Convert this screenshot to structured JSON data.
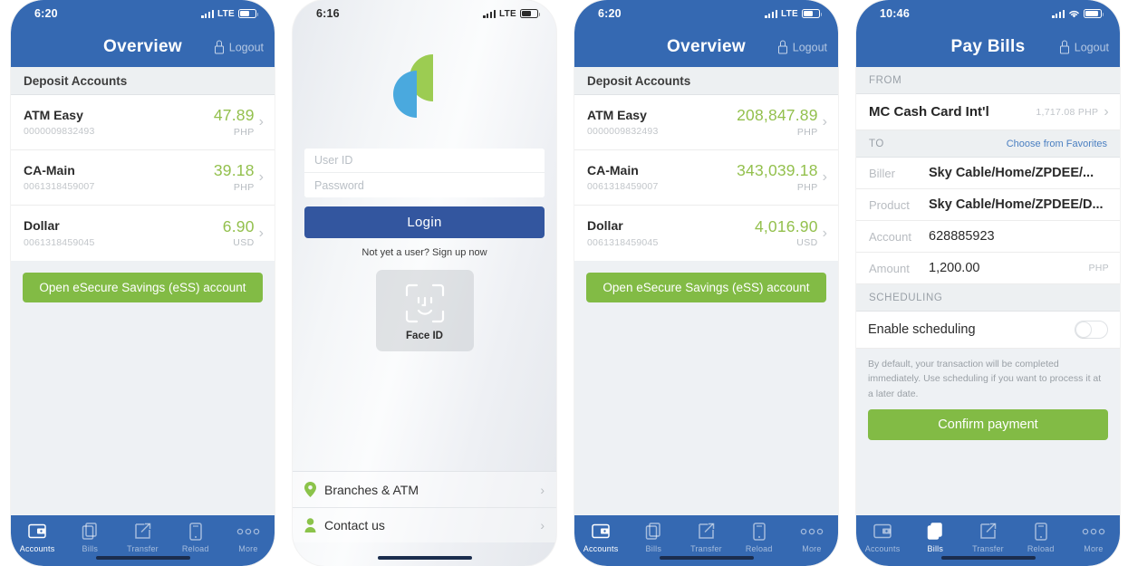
{
  "screens": [
    {
      "id": "overview-small",
      "status": {
        "time": "6:20",
        "network": "LTE",
        "signal_icon": "signal-bars-icon",
        "battery_icon": "battery-icon"
      },
      "nav": {
        "title": "Overview",
        "logout_label": "Logout",
        "logout_icon": "lock-icon"
      },
      "section_header": "Deposit Accounts",
      "accounts": [
        {
          "name": "ATM Easy",
          "number": "0000009832493",
          "balance": "47.89",
          "currency": "PHP"
        },
        {
          "name": "CA-Main",
          "number": "0061318459007",
          "balance": "39.18",
          "currency": "PHP"
        },
        {
          "name": "Dollar",
          "number": "0061318459045",
          "balance": "6.90",
          "currency": "USD"
        }
      ],
      "cta_label": "Open eSecure Savings (eSS) account",
      "tabs": [
        {
          "label": "Accounts",
          "icon": "wallet-icon",
          "active": true
        },
        {
          "label": "Bills",
          "icon": "documents-icon",
          "active": false
        },
        {
          "label": "Transfer",
          "icon": "compose-icon",
          "active": false
        },
        {
          "label": "Reload",
          "icon": "phone-icon",
          "active": false
        },
        {
          "label": "More",
          "icon": "ellipsis-icon",
          "active": false
        }
      ]
    },
    {
      "id": "login",
      "status": {
        "time": "6:16",
        "network": "LTE",
        "signal_icon": "signal-bars-icon",
        "battery_icon": "battery-icon"
      },
      "logo_icon": "bank-s-logo",
      "fields": [
        {
          "name": "user-id",
          "placeholder": "User ID",
          "value": ""
        },
        {
          "name": "password",
          "placeholder": "Password",
          "value": ""
        }
      ],
      "login_label": "Login",
      "signup_text": "Not yet a user?  Sign up now",
      "faceid": {
        "label": "Face ID",
        "icon": "face-id-icon"
      },
      "links": [
        {
          "label": "Branches & ATM",
          "icon": "map-pin-icon"
        },
        {
          "label": "Contact us",
          "icon": "person-icon"
        }
      ]
    },
    {
      "id": "overview-large",
      "status": {
        "time": "6:20",
        "network": "LTE",
        "signal_icon": "signal-bars-icon",
        "battery_icon": "battery-icon"
      },
      "nav": {
        "title": "Overview",
        "logout_label": "Logout",
        "logout_icon": "lock-icon"
      },
      "section_header": "Deposit Accounts",
      "accounts": [
        {
          "name": "ATM Easy",
          "number": "0000009832493",
          "balance": "208,847.89",
          "currency": "PHP"
        },
        {
          "name": "CA-Main",
          "number": "0061318459007",
          "balance": "343,039.18",
          "currency": "PHP"
        },
        {
          "name": "Dollar",
          "number": "0061318459045",
          "balance": "4,016.90",
          "currency": "USD"
        }
      ],
      "cta_label": "Open eSecure Savings (eSS) account",
      "tabs": [
        {
          "label": "Accounts",
          "icon": "wallet-icon",
          "active": true
        },
        {
          "label": "Bills",
          "icon": "documents-icon",
          "active": false
        },
        {
          "label": "Transfer",
          "icon": "compose-icon",
          "active": false
        },
        {
          "label": "Reload",
          "icon": "phone-icon",
          "active": false
        },
        {
          "label": "More",
          "icon": "ellipsis-icon",
          "active": false
        }
      ]
    },
    {
      "id": "pay-bills",
      "status": {
        "time": "10:46",
        "network": "WiFi",
        "signal_icon": "signal-bars-icon",
        "wifi_icon": "wifi-icon",
        "battery_icon": "battery-icon"
      },
      "nav": {
        "title": "Pay Bills",
        "logout_label": "Logout",
        "logout_icon": "lock-icon"
      },
      "from": {
        "header": "FROM",
        "account_name": "MC Cash Card Int'l",
        "account_balance": "1,717.08 PHP"
      },
      "to": {
        "header": "TO",
        "favorites_link": "Choose from Favorites",
        "rows": [
          {
            "label": "Biller",
            "value": "Sky Cable/Home/ZPDEE/...",
            "suffix": ""
          },
          {
            "label": "Product",
            "value": "Sky Cable/Home/ZPDEE/D...",
            "suffix": ""
          },
          {
            "label": "Account",
            "value": "628885923",
            "suffix": ""
          },
          {
            "label": "Amount",
            "value": "1,200.00",
            "suffix": "PHP"
          }
        ]
      },
      "scheduling": {
        "header": "SCHEDULING",
        "toggle_label": "Enable scheduling",
        "toggle_state": "off",
        "help_text": "By default, your transaction will be completed immediately. Use scheduling if you want to process it at a later date."
      },
      "confirm_label": "Confirm payment",
      "tabs": [
        {
          "label": "Accounts",
          "icon": "wallet-icon",
          "active": false
        },
        {
          "label": "Bills",
          "icon": "documents-icon",
          "active": true
        },
        {
          "label": "Transfer",
          "icon": "compose-icon",
          "active": false
        },
        {
          "label": "Reload",
          "icon": "phone-icon",
          "active": false
        },
        {
          "label": "More",
          "icon": "ellipsis-icon",
          "active": false
        }
      ]
    }
  ],
  "colors": {
    "brand_blue": "#3569b2",
    "login_blue": "#33569f",
    "brand_green": "#82bb45",
    "balance_green": "#93c04d",
    "page_bg": "#eef1f4",
    "logo_green": "#9ccc52",
    "logo_blue": "#4aa9de"
  }
}
